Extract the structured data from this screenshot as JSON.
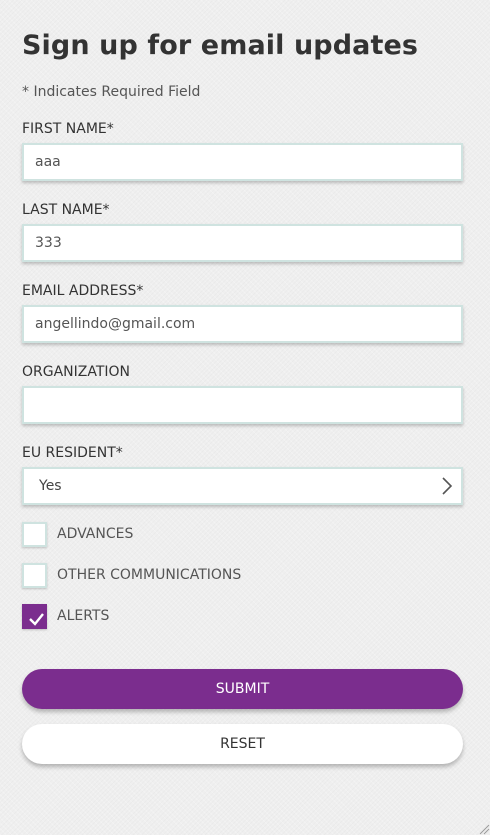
{
  "form": {
    "title": "Sign up for email updates",
    "required_note": "* Indicates Required Field",
    "first_name": {
      "label": "FIRST NAME*",
      "value": "aaa"
    },
    "last_name": {
      "label": "LAST NAME*",
      "value": "333"
    },
    "email": {
      "label": "EMAIL ADDRESS*",
      "value": "angellindo@gmail.com"
    },
    "organization": {
      "label": "ORGANIZATION",
      "value": ""
    },
    "eu_resident": {
      "label": "EU RESIDENT*",
      "selected": "Yes",
      "icon": "chevron-right-icon"
    },
    "checkboxes": [
      {
        "label": "ADVANCES",
        "checked": false
      },
      {
        "label": "OTHER COMMUNICATIONS",
        "checked": false
      },
      {
        "label": "ALERTS",
        "checked": true
      }
    ],
    "submit_label": "SUBMIT",
    "reset_label": "RESET"
  },
  "colors": {
    "accent": "#7b2d8e",
    "input_border": "#cfe3e0",
    "background": "#efefef"
  }
}
